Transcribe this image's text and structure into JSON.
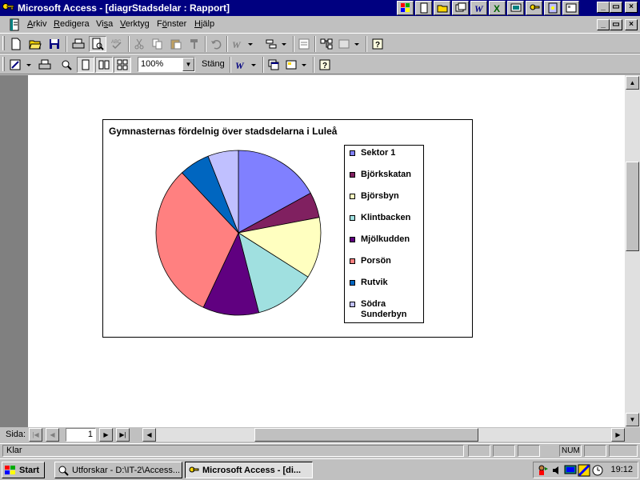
{
  "window": {
    "title": "Microsoft Access - [diagrStadsdelar : Rapport]"
  },
  "menubar": {
    "items": [
      "Arkiv",
      "Redigera",
      "Visa",
      "Verktyg",
      "Fönster",
      "Hjälp"
    ],
    "underline": [
      "A",
      "R",
      "s",
      "V",
      "ö",
      "H"
    ]
  },
  "toolbar2": {
    "zoom_value": "100%",
    "close_label": "Stäng"
  },
  "chart_data": {
    "type": "pie",
    "title": "Gymnasternas fördelnig över stadsdelarna i Luleå",
    "categories": [
      "Sektor 1",
      "Björkskatan",
      "Björsbyn",
      "Klintbacken",
      "Mjölkudden",
      "Porsön",
      "Rutvik",
      "Södra Sunderbyn"
    ],
    "values": [
      17,
      5,
      12,
      12,
      11,
      31,
      6,
      6
    ],
    "colors": [
      "#8080ff",
      "#802060",
      "#ffffc0",
      "#a0e0e0",
      "#600080",
      "#ff8080",
      "#0066c0",
      "#c0c0ff"
    ],
    "legend_position": "right"
  },
  "navigation": {
    "label": "Sida:",
    "page_number": "1"
  },
  "status": {
    "text": "Klar",
    "num": "NUM"
  },
  "taskbar": {
    "start_label": "Start",
    "tasks": [
      "Utforskar - D:\\IT-2\\Access...",
      "Microsoft Access - [di..."
    ],
    "clock": "19:12"
  }
}
